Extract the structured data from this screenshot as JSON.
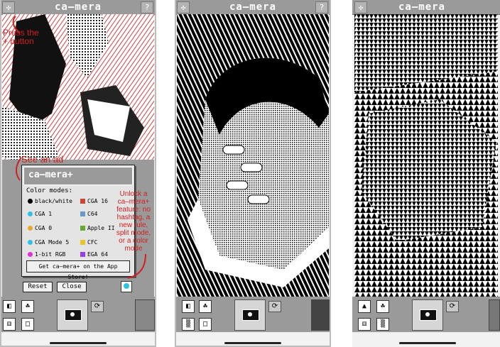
{
  "screens": [
    {
      "title": "ca–mera",
      "dialog": {
        "title": "ca–mera+",
        "color_modes_label": "Color modes:",
        "modes": [
          "black/white",
          "CGA 1",
          "CGA 0",
          "CGA Mode 5",
          "1-bit RGB",
          "CGA 16",
          "C64",
          "Apple II",
          "CFC",
          "EGA 64"
        ],
        "store_button": "Get ca–mera+ on the App Store!",
        "reset_button": "Reset",
        "close_button": "Close"
      },
      "annotations": {
        "press_plus": "Press the + button",
        "see_ad": "See an ad",
        "unlock": "Unlock a ca–mera+ feature: no hashtag, a new rule, split mode, or a color mode"
      }
    },
    {
      "title": "ca–mera"
    },
    {
      "title": "ca–mera"
    }
  ],
  "colors": {
    "accent_red": "#d21f1f",
    "titlebar_gray": "#9a9a9a"
  }
}
